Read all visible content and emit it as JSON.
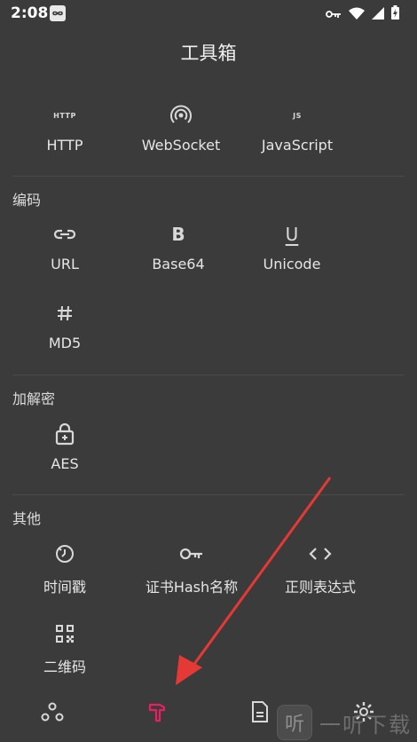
{
  "status_bar": {
    "time": "2:08"
  },
  "app": {
    "title": "工具箱"
  },
  "sections": {
    "network": {
      "tools": [
        {
          "label": "HTTP",
          "icon": "http-icon",
          "badge": "HTTP"
        },
        {
          "label": "WebSocket",
          "icon": "websocket-icon"
        },
        {
          "label": "JavaScript",
          "icon": "javascript-icon",
          "badge": "JS"
        }
      ]
    },
    "encoding": {
      "title": "编码",
      "tools": [
        {
          "label": "URL",
          "icon": "link-icon"
        },
        {
          "label": "Base64",
          "icon": "bold-b-icon",
          "glyph": "B"
        },
        {
          "label": "Unicode",
          "icon": "underline-u-icon",
          "glyph": "U"
        },
        {
          "label": "MD5",
          "icon": "hash-icon"
        }
      ]
    },
    "crypto": {
      "title": "加解密",
      "tools": [
        {
          "label": "AES",
          "icon": "lock-icon"
        }
      ]
    },
    "other": {
      "title": "其他",
      "tools": [
        {
          "label": "时间戳",
          "icon": "timer-icon"
        },
        {
          "label": "证书Hash名称",
          "icon": "key-icon"
        },
        {
          "label": "正则表达式",
          "icon": "code-brackets-icon"
        },
        {
          "label": "二维码",
          "icon": "qr-code-icon"
        }
      ]
    }
  },
  "bottom_nav": {
    "items": [
      {
        "name": "workflow",
        "icon": "nodes-icon"
      },
      {
        "name": "toolbox",
        "icon": "hammer-icon",
        "active": true
      },
      {
        "name": "document",
        "icon": "document-icon"
      },
      {
        "name": "settings",
        "icon": "gear-icon"
      }
    ]
  },
  "watermark": {
    "glyph": "听",
    "text": "一听下载"
  },
  "colors": {
    "background": "#3b3b3b",
    "text": "#e6e6e6",
    "accent": "#e91e63",
    "arrow": "#e53935",
    "icon": "#d8d8d8"
  }
}
